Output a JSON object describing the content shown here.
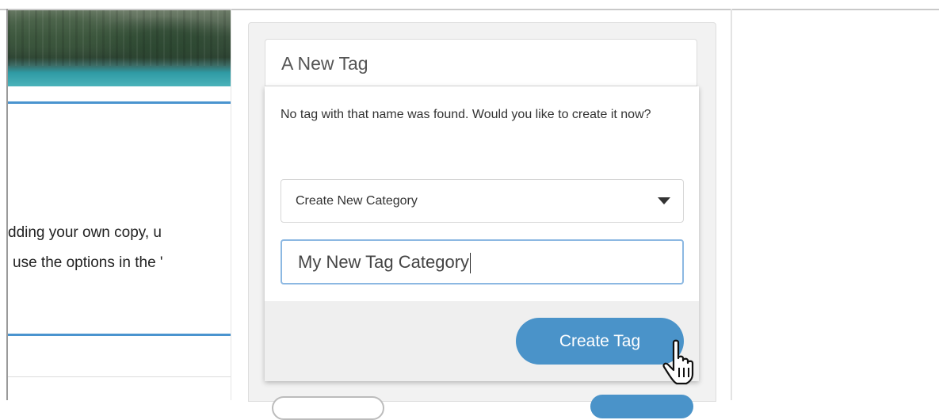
{
  "editor": {
    "body_line_1": "dding your own copy, u",
    "body_line_2": "use the options in the '"
  },
  "tag_panel": {
    "search_value": "A New Tag",
    "not_found_message": "No tag with that name was found. Would you like to create it now?",
    "category_select": {
      "selected": "Create New Category"
    },
    "new_category_input": {
      "value": "My New Tag Category"
    },
    "create_button_label": "Create Tag"
  },
  "colors": {
    "accent": "#4a93c9",
    "focus_border": "#8cb8e2",
    "rule_blue": "#4a94cf"
  },
  "icons": {
    "dropdown": "caret-down-icon",
    "pointer": "hand-pointer-icon"
  }
}
